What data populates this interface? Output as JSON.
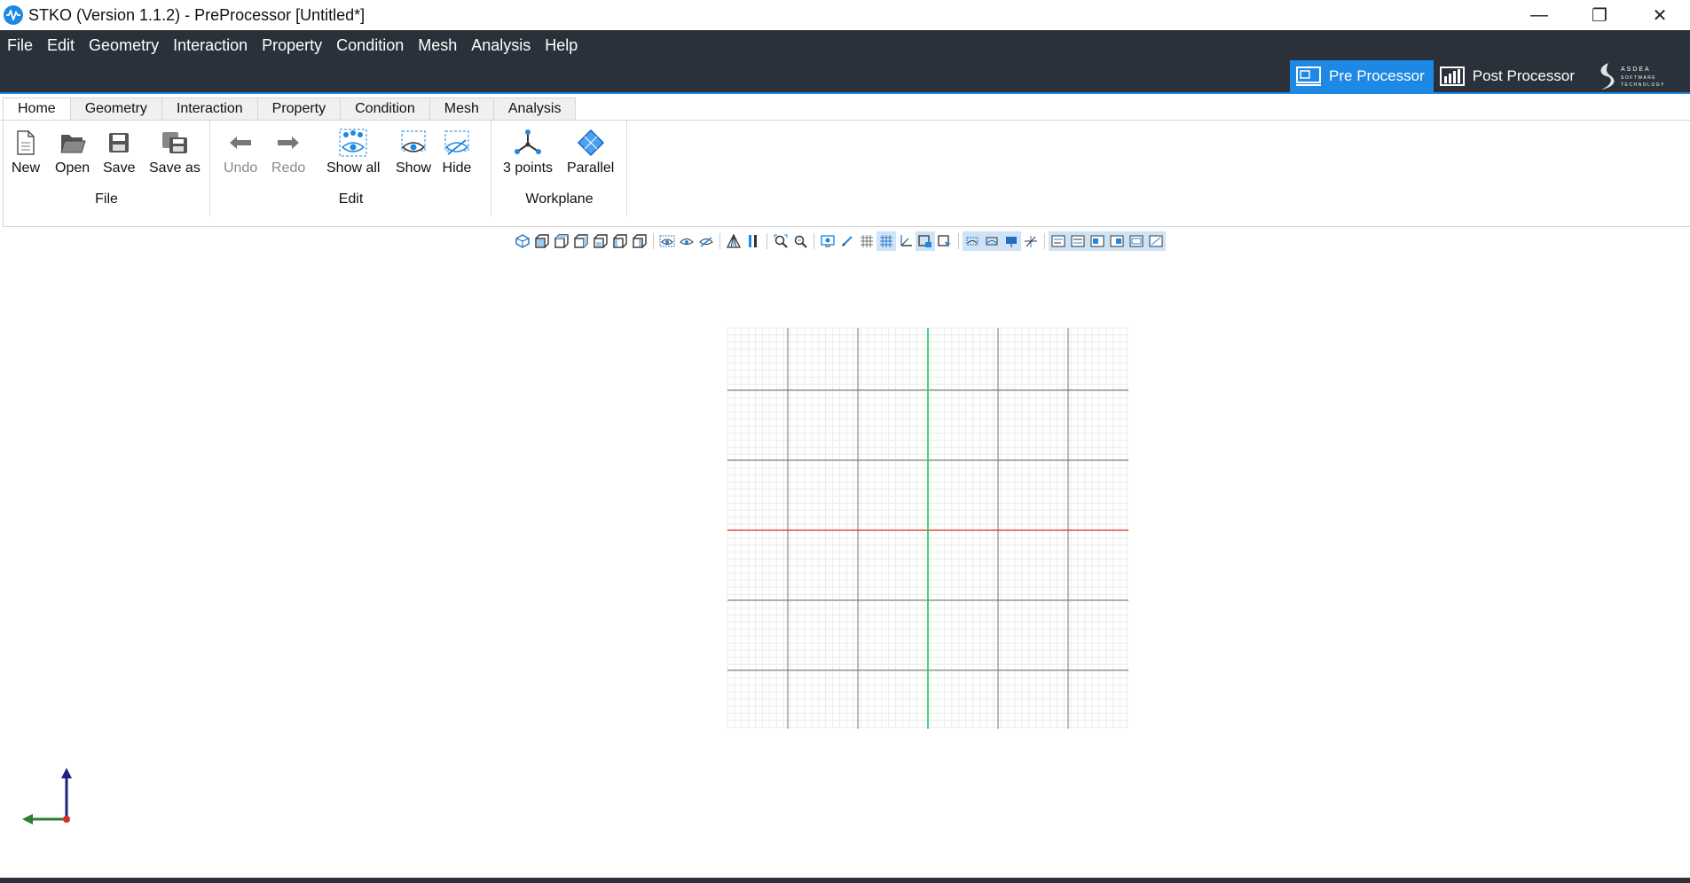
{
  "window": {
    "title": "STKO (Version 1.1.2) - PreProcessor [Untitled*]",
    "controls": {
      "minimize": "—",
      "restore": "❐",
      "close": "✕"
    }
  },
  "menu": [
    "File",
    "Edit",
    "Geometry",
    "Interaction",
    "Property",
    "Condition",
    "Mesh",
    "Analysis",
    "Help"
  ],
  "modes": {
    "pre": "Pre Processor",
    "post": "Post Processor",
    "active": "pre"
  },
  "brand": {
    "logo_text": "ASDEA SOFTWARE TECHNOLOGY"
  },
  "ribbon_tabs": [
    "Home",
    "Geometry",
    "Interaction",
    "Property",
    "Condition",
    "Mesh",
    "Analysis"
  ],
  "ribbon": {
    "file": {
      "label": "File",
      "new": "New",
      "open": "Open",
      "save": "Save",
      "save_as": "Save as"
    },
    "edit": {
      "label": "Edit",
      "undo": "Undo",
      "redo": "Redo",
      "show_all": "Show all",
      "show": "Show",
      "hide": "Hide"
    },
    "workplane": {
      "label": "Workplane",
      "three_points": "3 points",
      "parallel": "Parallel"
    }
  },
  "colors": {
    "accent": "#1e88e5",
    "menu_bg": "#2b313a",
    "axis_x": "#d32f2f",
    "axis_y": "#2e7d32",
    "axis_z": "#1a237e",
    "grid_green": "#22c55e",
    "grid_red": "#e53935"
  }
}
